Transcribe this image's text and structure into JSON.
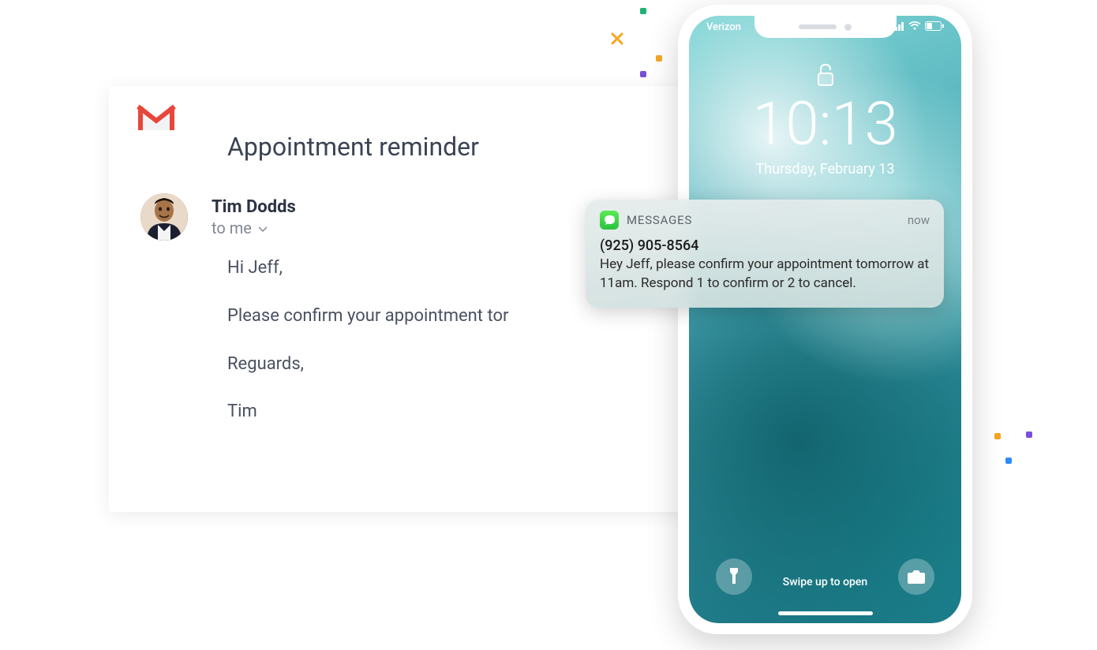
{
  "email": {
    "subject": "Appointment reminder",
    "sender_name": "Tim Dodds",
    "recipient_line": "to me",
    "body_greeting": "Hi Jeff,",
    "body_line1": "Please confirm your appointment tor",
    "body_signoff": "Reguards,",
    "body_signature": "Tim"
  },
  "phone": {
    "carrier": "Verizon",
    "time": "10:13",
    "date": "Thursday, February 13",
    "swipe_hint": "Swipe up to open"
  },
  "notification": {
    "app_name": "MESSAGES",
    "timestamp": "now",
    "sender": "(925) 905-8564",
    "body": "Hey Jeff, please confirm your appointment tomorrow at 11am. Respond 1 to confirm or 2 to cancel."
  }
}
